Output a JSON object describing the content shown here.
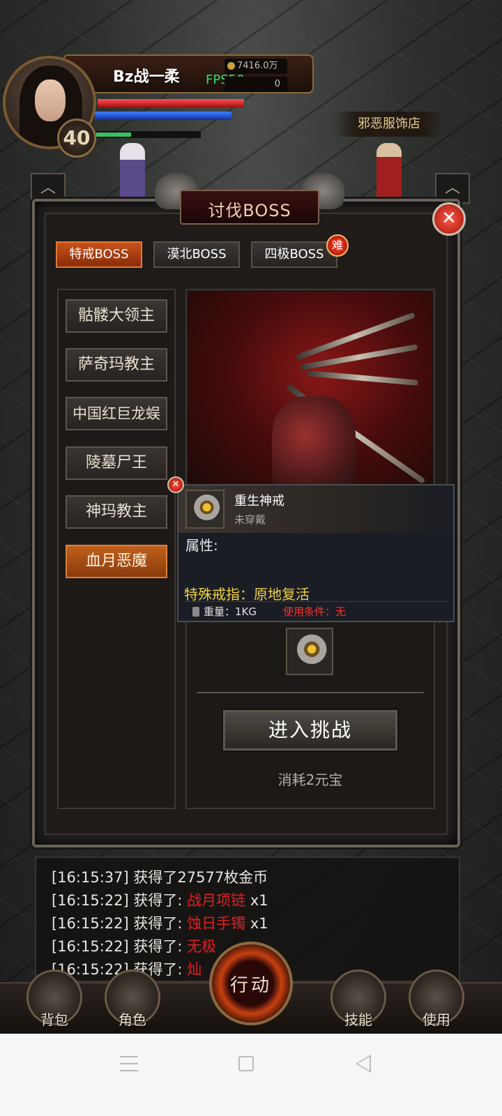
{
  "player": {
    "name": "Bz战一柔",
    "level": "40",
    "gold": "7416.0万",
    "fps": "FPS50",
    "ingot": "0"
  },
  "map": {
    "shop_label": "邪恶服饰店"
  },
  "panel": {
    "title": "讨伐BOSS",
    "close_icon": "close-icon",
    "tabs": [
      {
        "label": "特戒BOSS",
        "active": true
      },
      {
        "label": "漠北BOSS",
        "active": false
      },
      {
        "label": "四极BOSS",
        "active": false
      }
    ],
    "hard_badge": "难",
    "boss_list": [
      {
        "label": "骷髅大领主",
        "active": false
      },
      {
        "label": "萨奇玛教主",
        "active": false
      },
      {
        "label": "中国红巨龙蜈",
        "active": false
      },
      {
        "label": "陵墓尸王",
        "active": false
      },
      {
        "label": "神玛教主",
        "active": false
      },
      {
        "label": "血月恶魔",
        "active": true
      }
    ],
    "challenge_button": "进入挑战",
    "cost": "消耗2元宝"
  },
  "tooltip": {
    "item_name": "重生神戒",
    "status": "未穿戴",
    "attr_label": "属性:",
    "special": "特殊戒指：原地复活",
    "weight": "重量：1KG",
    "condition": "使用条件：无"
  },
  "chat": [
    {
      "time": "[16:15:37]",
      "text": " 获得了27577枚金币",
      "item": "",
      "suffix": ""
    },
    {
      "time": "[16:15:22]",
      "text": " 获得了: ",
      "item": "战月项链",
      "suffix": " x1"
    },
    {
      "time": "[16:15:22]",
      "text": " 获得了: ",
      "item": "蚀日手镯",
      "suffix": " x1"
    },
    {
      "time": "[16:15:22]",
      "text": " 获得了: ",
      "item": "无极",
      "suffix": ""
    },
    {
      "time": "[16:15:22]",
      "text": " 获得了: ",
      "item": "灿",
      "suffix": ""
    }
  ],
  "bottom_nav": {
    "bag": "背包",
    "role": "角色",
    "action": "行动",
    "skill": "技能",
    "use": "使用"
  }
}
